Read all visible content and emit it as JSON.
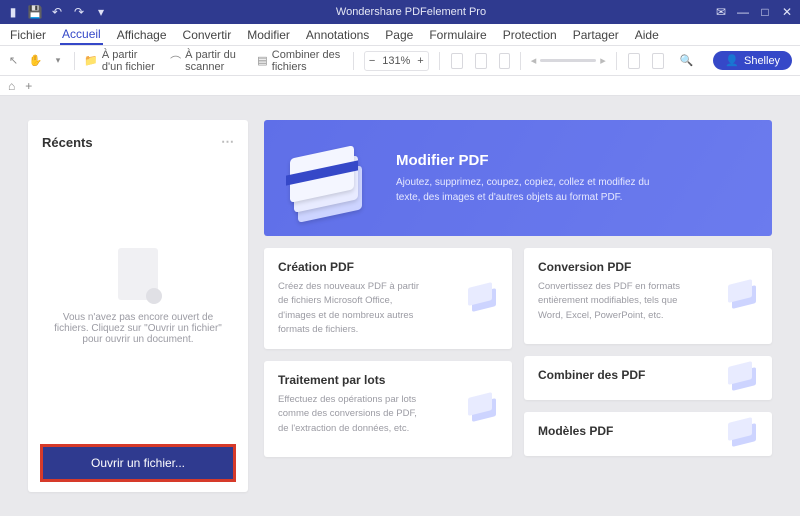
{
  "app": {
    "title": "Wondershare PDFelement Pro"
  },
  "menu": {
    "items": [
      "Fichier",
      "Accueil",
      "Affichage",
      "Convertir",
      "Modifier",
      "Annotations",
      "Page",
      "Formulaire",
      "Protection",
      "Partager",
      "Aide"
    ],
    "active_index": 1
  },
  "toolbar": {
    "from_file": "À partir d'un fichier",
    "from_scanner": "À partir du scanner",
    "combine": "Combiner des fichiers",
    "zoom": "131%"
  },
  "user": {
    "name": "Shelley"
  },
  "recents": {
    "title": "Récents",
    "empty_text": "Vous n'avez pas encore ouvert de fichiers. Cliquez sur \"Ouvrir un fichier\" pour ouvrir un document.",
    "open_label": "Ouvrir un fichier..."
  },
  "hero": {
    "title": "Modifier PDF",
    "desc": "Ajoutez, supprimez, coupez, copiez, collez et modifiez du texte, des images et d'autres objets au format PDF."
  },
  "cards": {
    "create": {
      "title": "Création PDF",
      "desc": "Créez des nouveaux PDF à partir de fichiers Microsoft Office, d'images et de nombreux autres formats de fichiers."
    },
    "convert": {
      "title": "Conversion PDF",
      "desc": "Convertissez des PDF en formats entièrement modifiables, tels que Word, Excel, PowerPoint, etc."
    },
    "batch": {
      "title": "Traitement par lots",
      "desc": "Effectuez des opérations par lots comme des conversions de PDF, de l'extraction de données, etc."
    },
    "combine": {
      "title": "Combiner des PDF"
    },
    "templates": {
      "title": "Modèles PDF"
    }
  }
}
